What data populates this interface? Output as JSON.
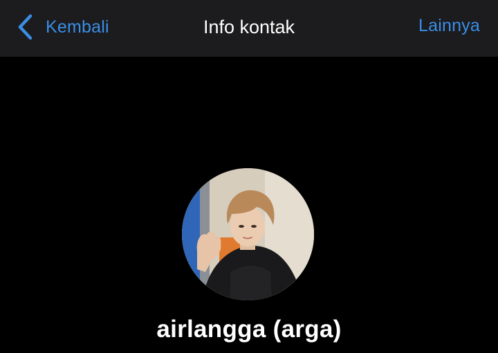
{
  "navbar": {
    "back_label": "Kembali",
    "title": "Info kontak",
    "more_label": "Lainnya",
    "back_icon": "chevron-left-icon"
  },
  "contact": {
    "name": "airlangga (arga)",
    "avatar": "profile-photo"
  },
  "colors": {
    "accent": "#3a8ee6",
    "navbar_bg": "#1c1c1e",
    "background": "#000000",
    "title_text": "#ffffff"
  }
}
